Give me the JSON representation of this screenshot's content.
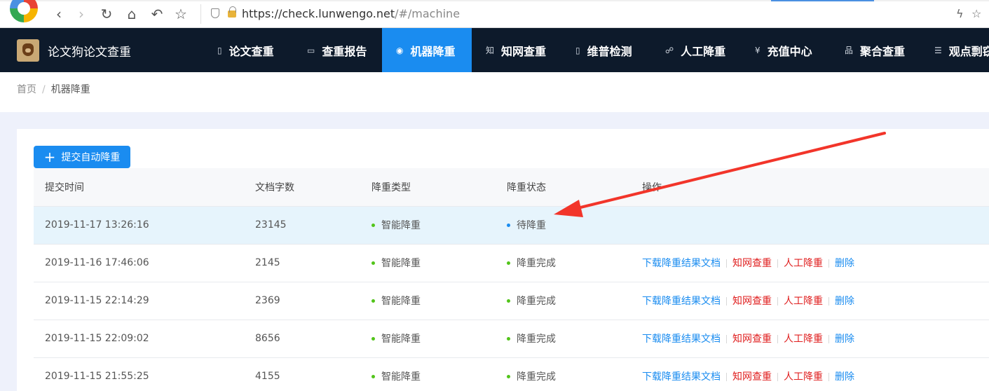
{
  "browser": {
    "url_host": "https://check.lunwengo.net",
    "url_path": "/#/machine"
  },
  "brand": {
    "name": "论文狗论文查重"
  },
  "nav": {
    "items": [
      {
        "label": "论文查重",
        "icon": "document-search-icon"
      },
      {
        "label": "查重报告",
        "icon": "report-icon"
      },
      {
        "label": "机器降重",
        "icon": "robot-icon",
        "active": true
      },
      {
        "label": "知网查重",
        "icon": "zhi-icon"
      },
      {
        "label": "维普检测",
        "icon": "book-icon"
      },
      {
        "label": "人工降重",
        "icon": "person-icon"
      },
      {
        "label": "充值中心",
        "icon": "yuan-icon"
      },
      {
        "label": "聚合查重",
        "icon": "tree-icon"
      },
      {
        "label": "观点剽窃",
        "icon": "list-icon"
      }
    ],
    "active_color": "#1a8cf0",
    "bg_color": "#0d1a2b"
  },
  "breadcrumb": {
    "home": "首页",
    "current": "机器降重"
  },
  "toolbar": {
    "submit_label": "提交自动降重"
  },
  "table": {
    "headers": [
      "提交时间",
      "文档字数",
      "降重类型",
      "降重状态",
      "操作"
    ],
    "rows": [
      {
        "time": "2019-11-17 13:26:16",
        "words": "23145",
        "type": "智能降重",
        "status": "待降重",
        "status_color": "#1a8cf0",
        "actions": false
      },
      {
        "time": "2019-11-16 17:46:06",
        "words": "2145",
        "type": "智能降重",
        "status": "降重完成",
        "status_color": "#52c41a",
        "actions": true
      },
      {
        "time": "2019-11-15 22:14:29",
        "words": "2369",
        "type": "智能降重",
        "status": "降重完成",
        "status_color": "#52c41a",
        "actions": true
      },
      {
        "time": "2019-11-15 22:09:02",
        "words": "8656",
        "type": "智能降重",
        "status": "降重完成",
        "status_color": "#52c41a",
        "actions": true
      },
      {
        "time": "2019-11-15 21:55:25",
        "words": "4155",
        "type": "智能降重",
        "status": "降重完成",
        "status_color": "#52c41a",
        "actions": true
      }
    ],
    "type_dot_color": "#52c41a",
    "actions": {
      "download": "下载降重结果文档",
      "cnki": "知网查重",
      "manual": "人工降重",
      "delete": "删除"
    },
    "action_colors": {
      "download": "#1a8cf0",
      "cnki": "#e02020",
      "manual": "#e02020",
      "delete": "#1a8cf0"
    }
  },
  "annotation": {
    "arrow_color": "#f2352a"
  }
}
